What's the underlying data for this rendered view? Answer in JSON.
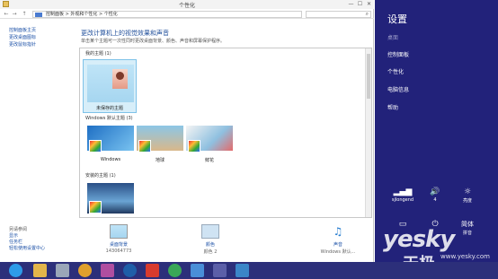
{
  "window": {
    "title": "个性化",
    "controls": [
      "—",
      "☐",
      "✕"
    ]
  },
  "address": {
    "path": "控制面板  >  外观和个性化  >  个性化",
    "nav": [
      "←",
      "→",
      "↑"
    ]
  },
  "leftnav": {
    "items": [
      "控制面板主页",
      "更改桌面图标",
      "更改鼠标指针"
    ],
    "see_also_heading": "另请参阅",
    "see_also": [
      "显示",
      "任务栏",
      "轻松使用设置中心"
    ]
  },
  "main": {
    "heading": "更改计算机上的视觉效果和声音",
    "subtitle": "单击某个主题可一次性同时更改桌面背景、颜色、声音和屏幕保护程序。",
    "sections": {
      "my_themes": "我的主题 (1)",
      "windows_default": "Windows 默认主题 (3)",
      "installed": "安装的主题 (1)"
    },
    "my_theme_caption": "未保存的主题",
    "default_themes": [
      "Windows",
      "地球",
      "鲜花"
    ]
  },
  "bottom": {
    "items": [
      {
        "label": "桌面背景",
        "sub": "143064773"
      },
      {
        "label": "颜色",
        "sub": "颜色 2"
      },
      {
        "label": "声音",
        "sub": "Windows 默认..."
      }
    ]
  },
  "charms": {
    "title": "设置",
    "items": [
      "桌面",
      "控制面板",
      "个性化",
      "电脑信息",
      "帮助"
    ],
    "quick": [
      {
        "icon": "signal-icon",
        "glyph": "▂▄▆",
        "label": "sjlongend"
      },
      {
        "icon": "volume-icon",
        "glyph": "🔊",
        "label": "4"
      },
      {
        "icon": "brightness-icon",
        "glyph": "☼",
        "label": "亮度"
      },
      {
        "icon": "notifications-icon",
        "glyph": "▭",
        "label": ""
      },
      {
        "icon": "power-icon",
        "glyph": "⏻",
        "label": ""
      },
      {
        "icon": "keyboard-icon",
        "glyph": "简体",
        "label": "拼音"
      }
    ],
    "accent": "#22227a"
  },
  "watermark": {
    "brand": "yesky",
    "cn": "天极",
    "site": "www.yesky.com"
  },
  "taskbar": {
    "color": "#2c2f7a"
  }
}
